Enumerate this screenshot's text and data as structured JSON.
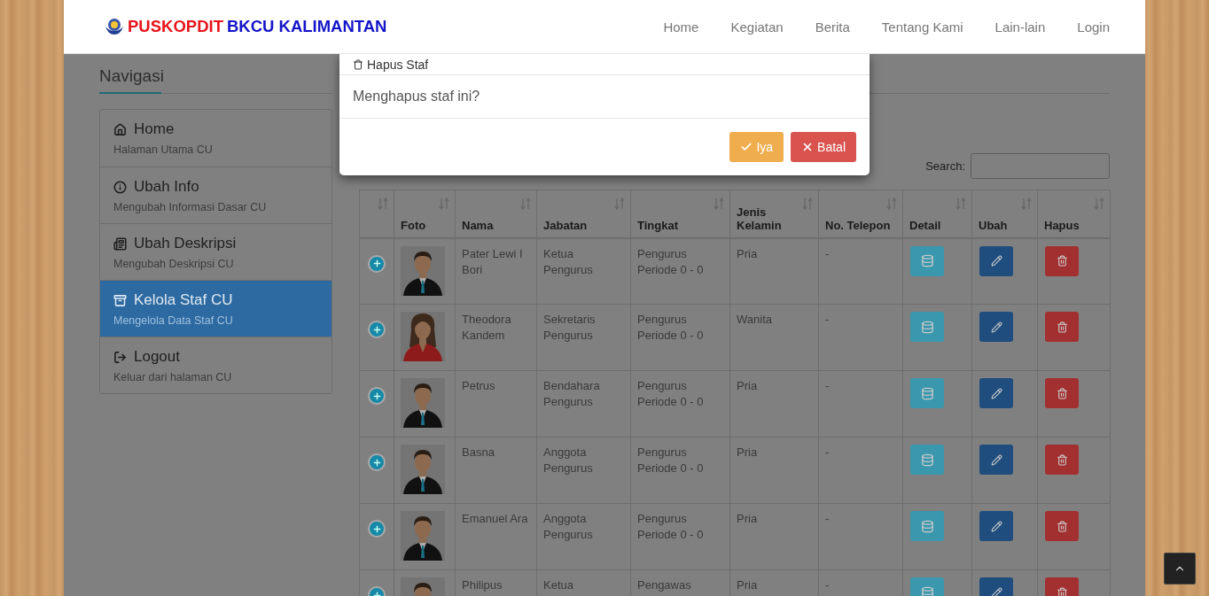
{
  "brand": {
    "red": "PUSKOPDIT",
    "blue": "BKCU KALIMANTAN"
  },
  "nav_links": [
    "Home",
    "Kegiatan",
    "Berita",
    "Tentang Kami",
    "Lain-lain",
    "Login"
  ],
  "sidebar": {
    "title": "Navigasi",
    "items": [
      {
        "label": "Home",
        "subtitle": "Halaman Utama CU",
        "selected": false
      },
      {
        "label": "Ubah Info",
        "subtitle": "Mengubah Informasi Dasar CU",
        "selected": false
      },
      {
        "label": "Ubah Deskripsi",
        "subtitle": "Mengubah Deskripsi CU",
        "selected": false
      },
      {
        "label": "Kelola Staf CU",
        "subtitle": "Mengelola Data Staf CU",
        "selected": true
      },
      {
        "label": "Logout",
        "subtitle": "Keluar dari halaman CU",
        "selected": false
      }
    ]
  },
  "search": {
    "label": "Search:"
  },
  "table": {
    "columns": [
      "Foto",
      "Nama",
      "Jabatan",
      "Tingkat",
      "Jenis Kelamin",
      "No. Telepon",
      "Detail",
      "Ubah",
      "Hapus"
    ],
    "rows": [
      {
        "kind": "male",
        "nama": "Pater Lewi I Bori",
        "jabatan": "Ketua Pengurus",
        "tingkat": "Pengurus Periode 0 - 0",
        "jenis_kelamin": "Pria",
        "telepon": "-"
      },
      {
        "kind": "female",
        "nama": "Theodora Kandem",
        "jabatan": "Sekretaris Pengurus",
        "tingkat": "Pengurus Periode 0 - 0",
        "jenis_kelamin": "Wanita",
        "telepon": "-"
      },
      {
        "kind": "male",
        "nama": "Petrus",
        "jabatan": "Bendahara Pengurus",
        "tingkat": "Pengurus Periode 0 - 0",
        "jenis_kelamin": "Pria",
        "telepon": "-"
      },
      {
        "kind": "male",
        "nama": "Basna",
        "jabatan": "Anggota Pengurus",
        "tingkat": "Pengurus Periode 0 - 0",
        "jenis_kelamin": "Pria",
        "telepon": "-"
      },
      {
        "kind": "male",
        "nama": "Emanuel Ara",
        "jabatan": "Anggota Pengurus",
        "tingkat": "Pengurus Periode 0 - 0",
        "jenis_kelamin": "Pria",
        "telepon": "-"
      },
      {
        "kind": "male",
        "nama": "Philipus",
        "jabatan": "Ketua",
        "tingkat": "Pengawas",
        "jenis_kelamin": "Pria",
        "telepon": "-"
      }
    ]
  },
  "dialog": {
    "title": "Hapus Staf",
    "message": "Menghapus staf ini?",
    "buttons": [
      {
        "kind": "confirm",
        "label": "Iya"
      },
      {
        "kind": "cancel",
        "label": "Batal"
      }
    ]
  }
}
